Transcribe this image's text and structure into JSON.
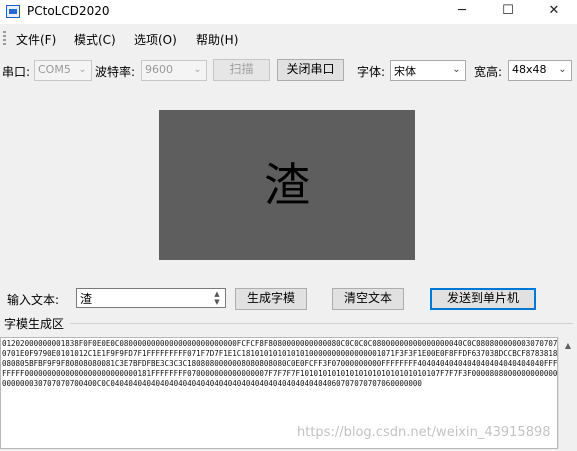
{
  "window": {
    "title": "PCtoLCD2020",
    "minimize_glyph": "─",
    "maximize_glyph": "☐",
    "close_glyph": "✕"
  },
  "menu": [
    "文件(F)",
    "模式(C)",
    "选项(O)",
    "帮助(H)"
  ],
  "toolbar": {
    "port_label": "串口:",
    "port_value": "COM5",
    "baud_label": "波特率:",
    "baud_value": "9600",
    "scan_button": "扫描",
    "close_port_button": "关闭串口",
    "font_label": "字体:",
    "font_value": "宋体",
    "size_label": "宽高:",
    "size_value": "48x48"
  },
  "preview": {
    "character": "渣"
  },
  "input": {
    "label": "输入文本:",
    "value": "渣",
    "generate_button": "生成字模",
    "clear_button": "清空文本",
    "send_button": "发送到单片机"
  },
  "output": {
    "group_label": "字模生成区",
    "text": "01202000000001838F0F0E0E0C08000000000000000000000000FCFCF8F8080000000000080C0C0C0C08000000000000000040C0C0808000000030707070701E0F9790E0101012C1E1F9F9FD7F1FFFFFFFFF071F7D7F1E1C1810101010101010000000000000001071F3F3F1E00E0F8FFDF637038DCCBCF8783818080805BFBF9F9F80808080081C3E7BFDFBE3C3C3C1808080000008080808080C0E0FCFF3F07000000000FFFFFFFF4040404040404040404040404040FFFFFFFF0000000000000000000000000181FFFFFFFF070000000000000007F7F7F7F1010101010101010101010101010107F7F7F3F0000808000000000000000000030707070700400C0C040404040404040404040404040404040404040404040404060707070707060000000"
  },
  "watermark": "https://blog.csdn.net/weixin_43915898"
}
